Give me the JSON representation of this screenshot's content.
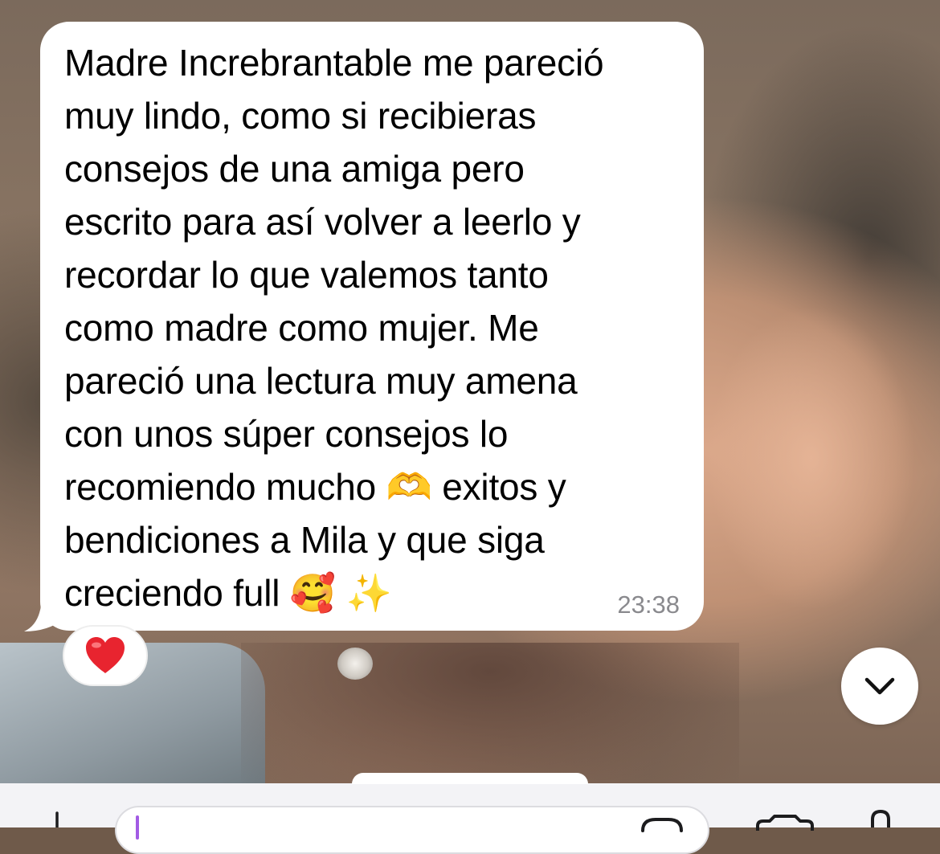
{
  "message": {
    "text": "Madre Increbrantable me pareció\nmuy lindo, como si recibieras\nconsejos de una amiga pero\nescrito para así volver a leerlo y\nrecordar lo que valemos tanto\ncomo madre como mujer. Me\npareció una lectura muy amena\ncon unos súper consejos lo\nrecomiendo mucho 🫶 exitos y\nbendiciones a Mila y que siga\ncreciendo full 🥰 ✨",
    "time": "23:38",
    "reaction": "heart-emoji"
  },
  "icons": {
    "scroll_down": "chevron-down-icon",
    "attach": "plus-icon",
    "sticker": "sticker-icon",
    "camera": "camera-icon",
    "mic": "microphone-icon"
  },
  "colors": {
    "bubble": "#ffffff",
    "timestamp": "#8a8a8e",
    "caret": "#a25be4",
    "reaction_heart": "#e8242f"
  }
}
